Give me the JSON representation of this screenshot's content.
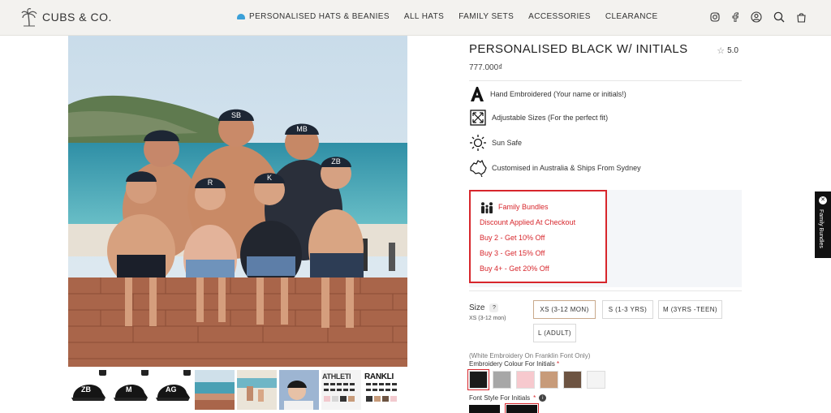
{
  "header": {
    "logo_text": "CUBS & CO.",
    "nav": [
      {
        "label": "PERSONALISED HATS & BEANIES"
      },
      {
        "label": "ALL HATS"
      },
      {
        "label": "FAMILY SETS"
      },
      {
        "label": "ACCESSORIES"
      },
      {
        "label": "CLEARANCE"
      }
    ]
  },
  "gallery": {
    "thumb_letters": [
      "ZB",
      "M",
      "AG"
    ],
    "thumb_font_samples": [
      "ATHLETI",
      "RANKLI"
    ]
  },
  "product": {
    "title": "PERSONALISED BLACK W/ INITIALS",
    "rating": "5.0",
    "price": "777.000₫",
    "features": [
      {
        "icon": "letter-a-icon",
        "text": "Hand Embroidered (Your name or initials!)"
      },
      {
        "icon": "adjust-arrows-icon",
        "text": "Adjustable Sizes (For the perfect fit)"
      },
      {
        "icon": "sun-icon",
        "text": "Sun Safe"
      },
      {
        "icon": "australia-map-icon",
        "text": "Customised in Australia & Ships From Sydney"
      }
    ],
    "bundles": {
      "title": "Family Bundles",
      "lines": [
        "Discount Applied At Checkout",
        "Buy 2 - Get 10% Off",
        "Buy 3 - Get 15% Off",
        "Buy 4+ - Get 20% Off"
      ],
      "color": "#d7262c"
    },
    "size": {
      "label": "Size",
      "selected_text": "XS (3-12 mon)",
      "options": [
        "XS (3-12 MON)",
        "S (1-3 YRS)",
        "M (3YRS -TEEN)",
        "L (ADULT)"
      ]
    },
    "embroidery": {
      "note": "(White Embroidery On Franklin Font Only)",
      "label": "Embroidery Colour For Initials",
      "required_mark": "*",
      "swatches": [
        "#1b1b1b",
        "#a7a7a7",
        "#f7c9ce",
        "#c79b7a",
        "#6d5442",
        "#f4f4f4"
      ]
    },
    "font_style": {
      "label": "Font Style For Initials",
      "required_mark": "*"
    }
  },
  "side_tab": {
    "label": "Family Bundles"
  }
}
